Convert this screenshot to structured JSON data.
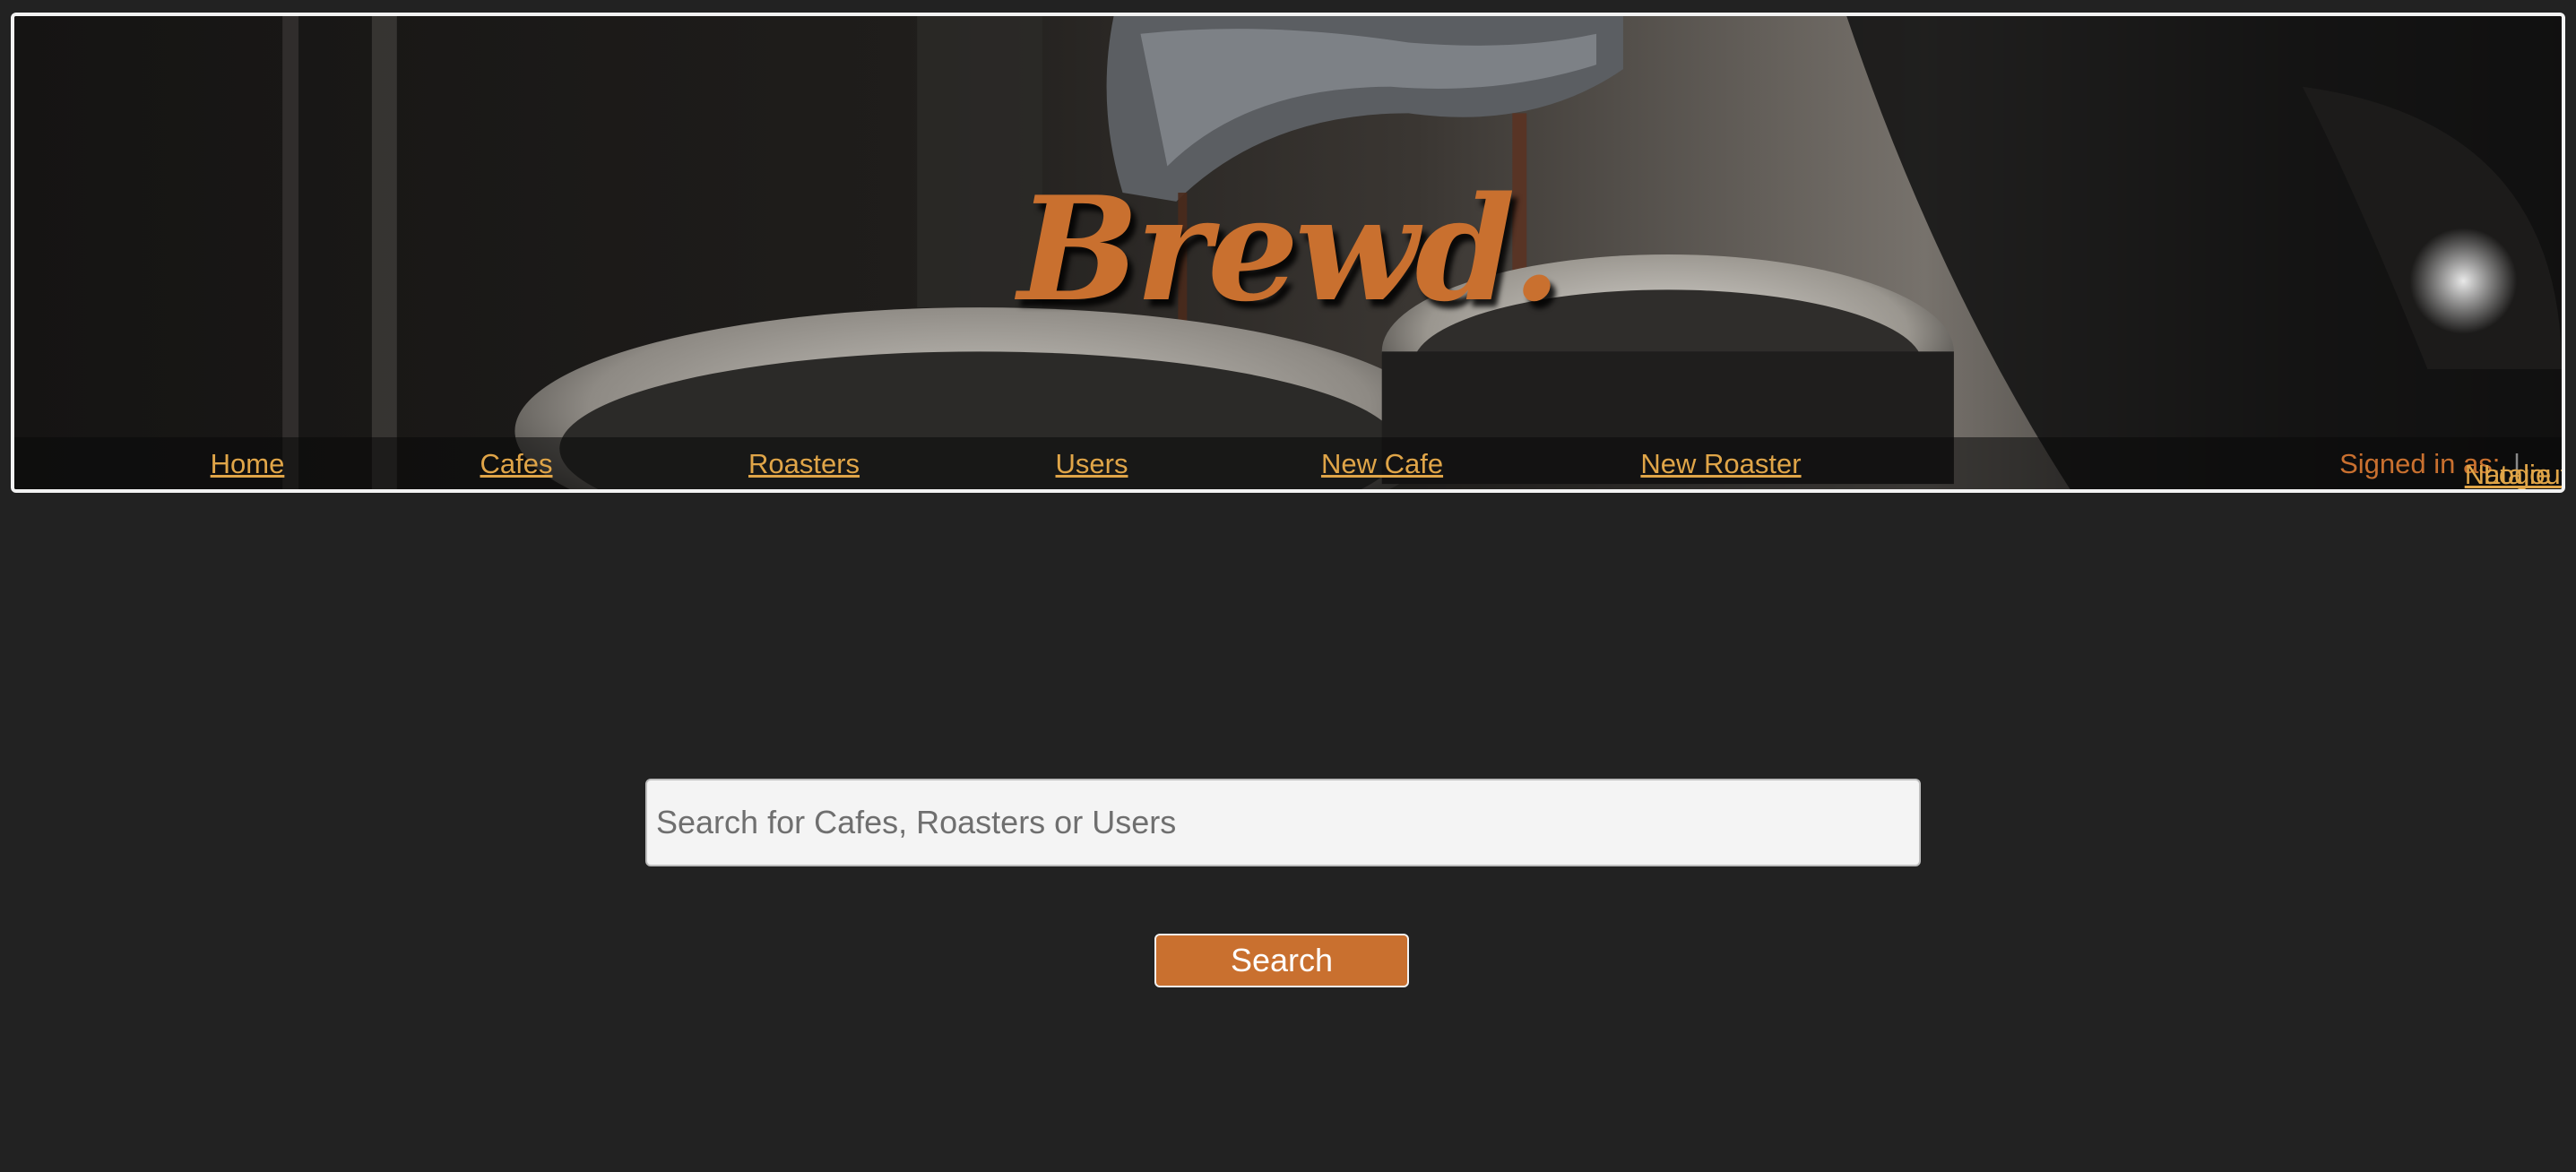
{
  "brand": {
    "logo_text": "Brewd."
  },
  "nav": {
    "items": [
      {
        "label": "Home"
      },
      {
        "label": "Cafes"
      },
      {
        "label": "Roasters"
      },
      {
        "label": "Users"
      },
      {
        "label": "New Cafe"
      },
      {
        "label": "New Roaster"
      }
    ],
    "signed_in_prefix": "Signed in as:",
    "username": "Natalie",
    "separator": "|",
    "logout_label": "Logout"
  },
  "search": {
    "placeholder": "Search for Cafes, Roasters or Users",
    "value": "",
    "button_label": "Search"
  },
  "colors": {
    "page_background": "#222222",
    "brand_orange": "#c9702f",
    "link_gold": "#e0a548",
    "input_background": "#f4f4f4"
  }
}
